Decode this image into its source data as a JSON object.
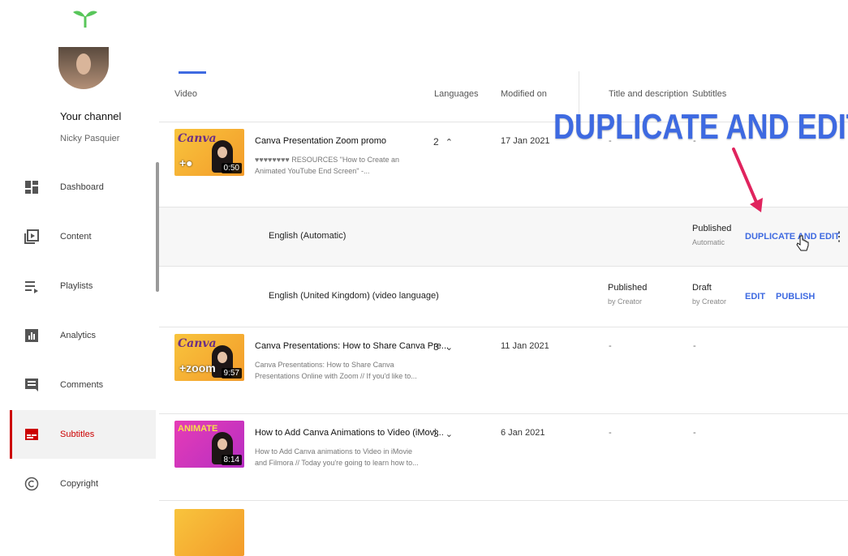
{
  "sidebar": {
    "channel_title": "Your channel",
    "channel_name": "Nicky Pasquier",
    "items": [
      {
        "label": "Dashboard",
        "icon": "dashboard-icon"
      },
      {
        "label": "Content",
        "icon": "content-icon"
      },
      {
        "label": "Playlists",
        "icon": "playlists-icon"
      },
      {
        "label": "Analytics",
        "icon": "analytics-icon"
      },
      {
        "label": "Comments",
        "icon": "comments-icon"
      },
      {
        "label": "Subtitles",
        "icon": "subtitles-icon"
      },
      {
        "label": "Copyright",
        "icon": "copyright-icon"
      }
    ],
    "active": "Subtitles"
  },
  "table": {
    "columns": [
      "Video",
      "Languages",
      "Modified on",
      "Title and description",
      "Subtitles"
    ],
    "rows": [
      {
        "title": "Canva Presentation Zoom promo",
        "desc": "♥♥♥♥♥♥♥♥ RESOURCES \"How to Create an Animated YouTube End Screen\" -...",
        "languages": "2",
        "chevron": "^",
        "modified": "17 Jan 2021",
        "title_desc": "-",
        "subtitles": "-",
        "duration": "0:50",
        "thumb_text": "Canva"
      },
      {
        "title": "Canva Presentations: How to Share Canva Pre...",
        "desc": "Canva Presentations: How to Share Canva Presentations Online with Zoom // If you'd like to...",
        "languages": "3",
        "chevron": "v",
        "modified": "11 Jan 2021",
        "title_desc": "-",
        "subtitles": "-",
        "duration": "9:57",
        "thumb_text": "Canva"
      },
      {
        "title": "How to Add Canva Animations to Video (iMovi...",
        "desc": "How to Add Canva animations to Video in iMovie and Filmora // Today you're going to learn how to...",
        "languages": "3",
        "chevron": "v",
        "modified": "6 Jan 2021",
        "title_desc": "-",
        "subtitles": "-",
        "duration": "8:14",
        "thumb_text": "ANIMATE"
      }
    ],
    "sub_rows": [
      {
        "language": "English (Automatic)",
        "subtitle_status": "Published",
        "subtitle_by": "Automatic",
        "action": "DUPLICATE AND EDIT"
      },
      {
        "language": "English (United Kingdom) (video language)",
        "title_status": "Published",
        "title_by": "by Creator",
        "subtitle_status": "Draft",
        "subtitle_by": "by Creator",
        "action_edit": "EDIT",
        "action_publish": "PUBLISH"
      }
    ]
  },
  "overlay_text": "DUPLICATE AND EDIT",
  "colors": {
    "accent": "#3e6ae1",
    "active_nav": "#cc0000",
    "arrow": "#e0245e"
  }
}
